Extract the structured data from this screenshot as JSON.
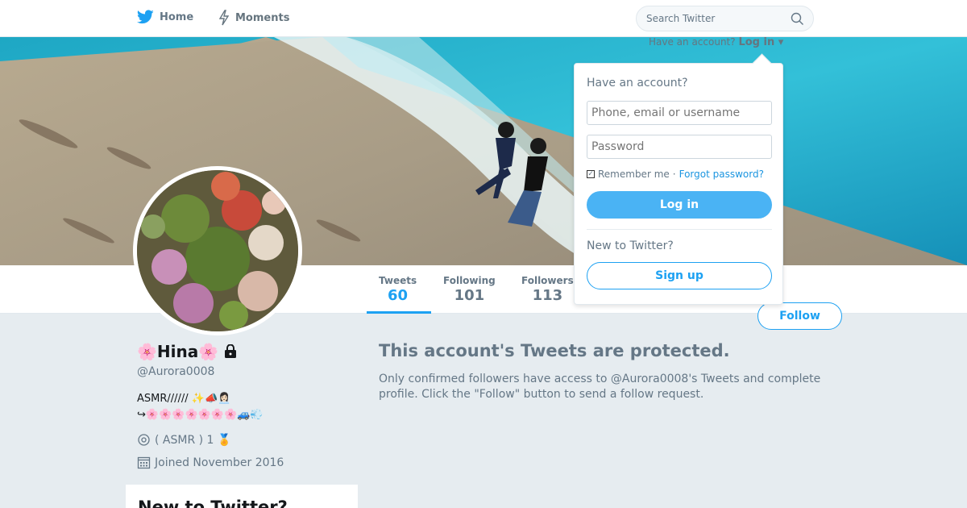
{
  "nav": {
    "home_label": "Home",
    "moments_label": "Moments",
    "search_placeholder": "Search Twitter"
  },
  "account_prompt": {
    "text": "Have an account?",
    "login_label": "Log in"
  },
  "login_dropdown": {
    "title": "Have an account?",
    "username_placeholder": "Phone, email or username",
    "password_placeholder": "Password",
    "remember_label": "Remember me",
    "separator": "·",
    "forgot_label": "Forgot password?",
    "login_button": "Log in",
    "new_label": "New to Twitter?",
    "signup_button": "Sign up"
  },
  "stats": [
    {
      "label": "Tweets",
      "value": "60"
    },
    {
      "label": "Following",
      "value": "101"
    },
    {
      "label": "Followers",
      "value": "113"
    }
  ],
  "follow_button": "Follow",
  "profile": {
    "name": "🌸Hina🌸",
    "handle": "@Aurora0008",
    "bio_line1": "ASMR//////            ✨📣👩🏻‍💼",
    "bio_line2": "↪︎🌸🌸🌸🌸🌸🌸🌸🚙💨",
    "location": "( ASMR ) 1               🏅",
    "joined": "Joined November 2016"
  },
  "protected": {
    "title": "This account's Tweets are protected.",
    "body": "Only confirmed followers have access to @Aurora0008's Tweets and complete profile. Click the \"Follow\" button to send a follow request."
  },
  "sidebar_card": {
    "title": "New to Twitter?"
  },
  "colors": {
    "brand": "#1da1f2",
    "text_secondary": "#657786",
    "background": "#e6ecf0"
  }
}
